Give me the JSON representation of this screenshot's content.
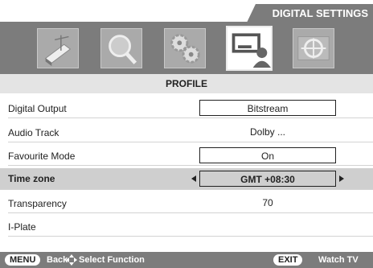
{
  "header": {
    "section_title": "DIGITAL SETTINGS"
  },
  "icons": [
    {
      "name": "channel-flag-icon",
      "selected": false
    },
    {
      "name": "search-icon",
      "selected": false
    },
    {
      "name": "gears-icon",
      "selected": false
    },
    {
      "name": "profile-user-icon",
      "selected": true
    },
    {
      "name": "test-pattern-icon",
      "selected": false
    }
  ],
  "page": {
    "title": "PROFILE"
  },
  "rows": [
    {
      "label": "Digital Output",
      "value": "Bitstream",
      "boxed": true
    },
    {
      "label": "Audio Track",
      "value": "Dolby ...",
      "boxed": false
    },
    {
      "label": "Favourite Mode",
      "value": "On",
      "boxed": true
    },
    {
      "label": "Time zone",
      "value": "GMT +08:30",
      "selected": true
    },
    {
      "label": "Transparency",
      "value": "70",
      "boxed": false
    },
    {
      "label": "I-Plate",
      "value": "",
      "boxed": false
    }
  ],
  "footer": {
    "menu_key": "MENU",
    "back_label": "Back",
    "select_label": "Select Function",
    "exit_key": "EXIT",
    "watch_label": "Watch TV"
  },
  "colors": {
    "bar": "#7c7c7c",
    "band": "#e4e4e4",
    "selected_row": "#cfcfcf"
  }
}
